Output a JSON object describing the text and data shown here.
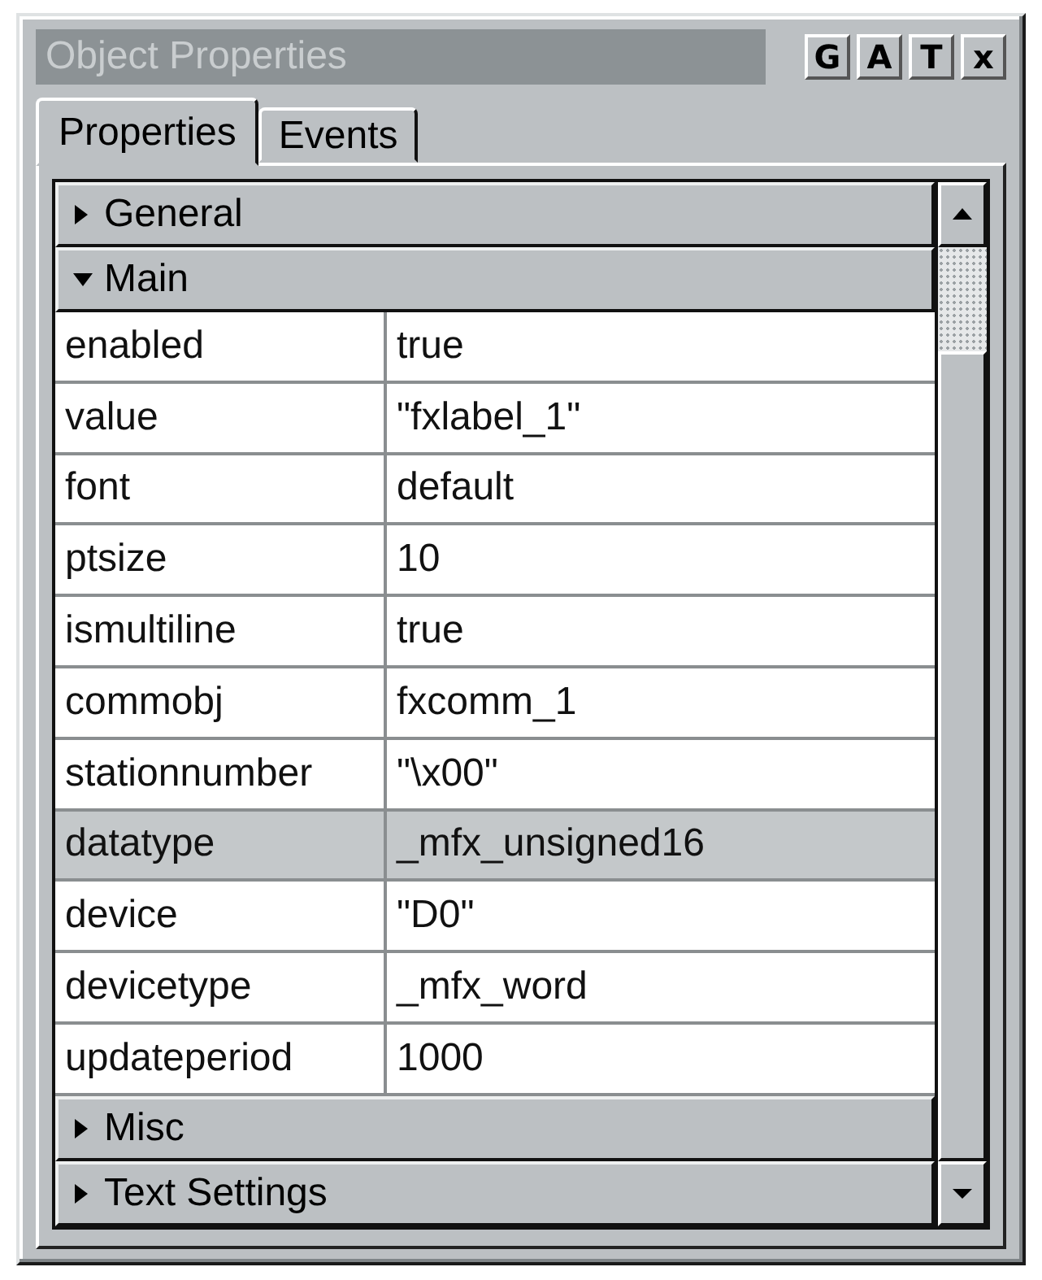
{
  "window": {
    "title": "Object Properties",
    "buttons": [
      "G",
      "A",
      "T",
      "x"
    ]
  },
  "tabs": [
    {
      "label": "Properties",
      "selected": true
    },
    {
      "label": "Events",
      "selected": false
    }
  ],
  "sections": [
    {
      "name": "General",
      "expanded": false
    },
    {
      "name": "Main",
      "expanded": true,
      "rows": [
        {
          "name": "enabled",
          "value": "true",
          "selected": false
        },
        {
          "name": "value",
          "value": "\"fxlabel_1\"",
          "selected": false
        },
        {
          "name": "font",
          "value": "default",
          "selected": false
        },
        {
          "name": "ptsize",
          "value": "10",
          "selected": false
        },
        {
          "name": "ismultiline",
          "value": "true",
          "selected": false
        },
        {
          "name": "commobj",
          "value": "fxcomm_1",
          "selected": false
        },
        {
          "name": "stationnumber",
          "value": "\"\\x00\"",
          "selected": false
        },
        {
          "name": "datatype",
          "value": "_mfx_unsigned16",
          "selected": true
        },
        {
          "name": "device",
          "value": "\"D0\"",
          "selected": false
        },
        {
          "name": "devicetype",
          "value": "_mfx_word",
          "selected": false
        },
        {
          "name": "updateperiod",
          "value": "1000",
          "selected": false
        }
      ]
    },
    {
      "name": "Misc",
      "expanded": false
    },
    {
      "name": "Text Settings",
      "expanded": false
    }
  ]
}
